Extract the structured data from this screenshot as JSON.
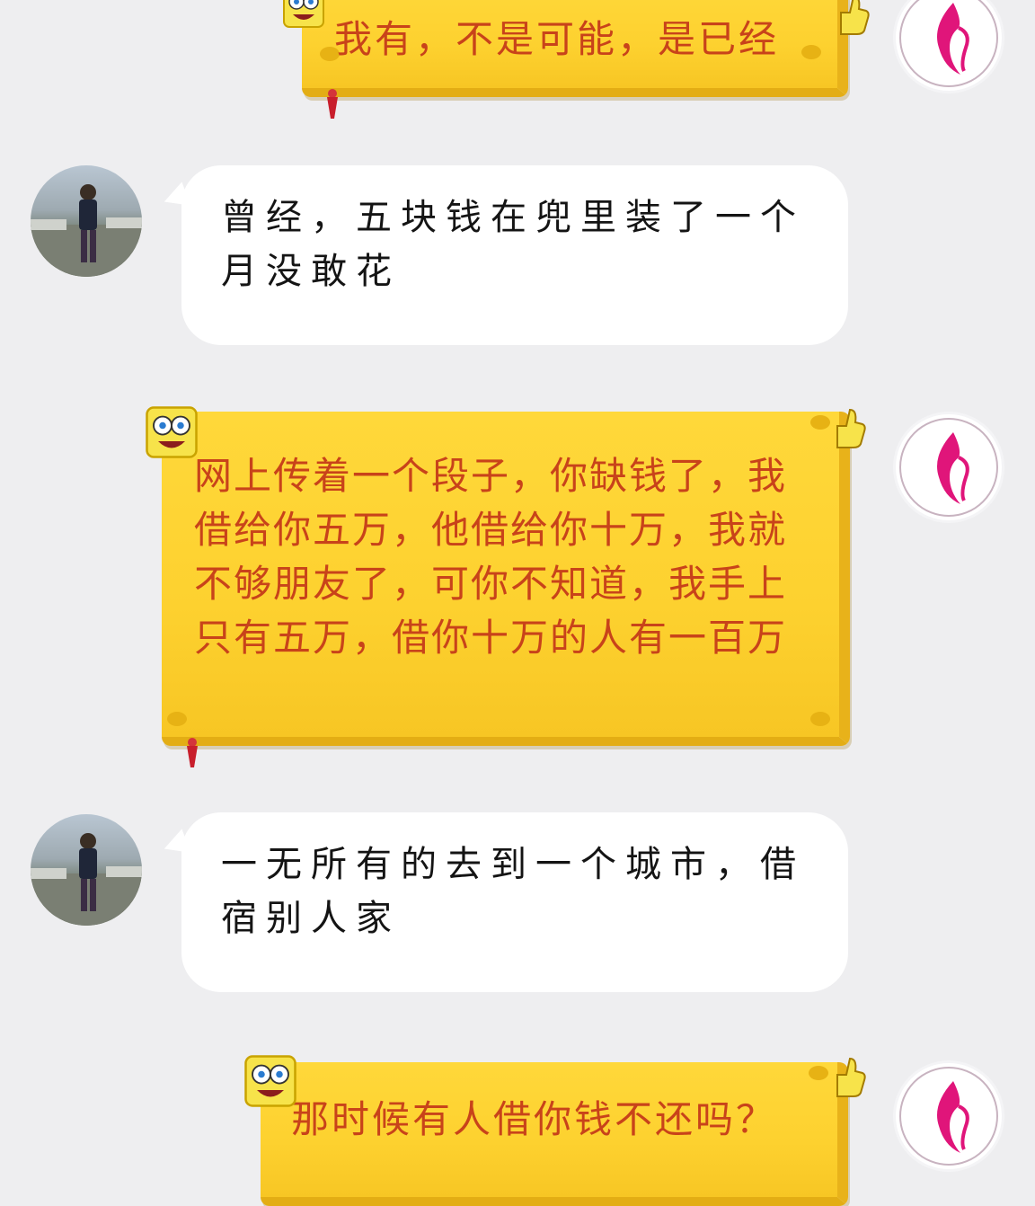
{
  "messages": [
    {
      "side": "right",
      "style": "yellow",
      "text": "我有，不是可能，是已经",
      "avatar": "brand-avatar"
    },
    {
      "side": "left",
      "style": "white",
      "text": "曾经，五块钱在兜里装了一个月没敢花",
      "avatar": "user-photo-avatar"
    },
    {
      "side": "right",
      "style": "yellow",
      "text": "网上传着一个段子，你缺钱了，我借给你五万，他借给你十万，我就不够朋友了，可你不知道，我手上只有五万，借你十万的人有一百万",
      "avatar": "brand-avatar"
    },
    {
      "side": "left",
      "style": "white",
      "text": "一无所有的去到一个城市，借宿别人家",
      "avatar": "user-photo-avatar"
    },
    {
      "side": "right",
      "style": "yellow",
      "text": "那时候有人借你钱不还吗？",
      "avatar": "brand-avatar"
    }
  ],
  "colors": {
    "background": "#eeeef0",
    "yellow_bubble": "#fdd12f",
    "yellow_text": "#c8431a",
    "brand_magenta": "#e0157a",
    "white_text": "#141414"
  }
}
